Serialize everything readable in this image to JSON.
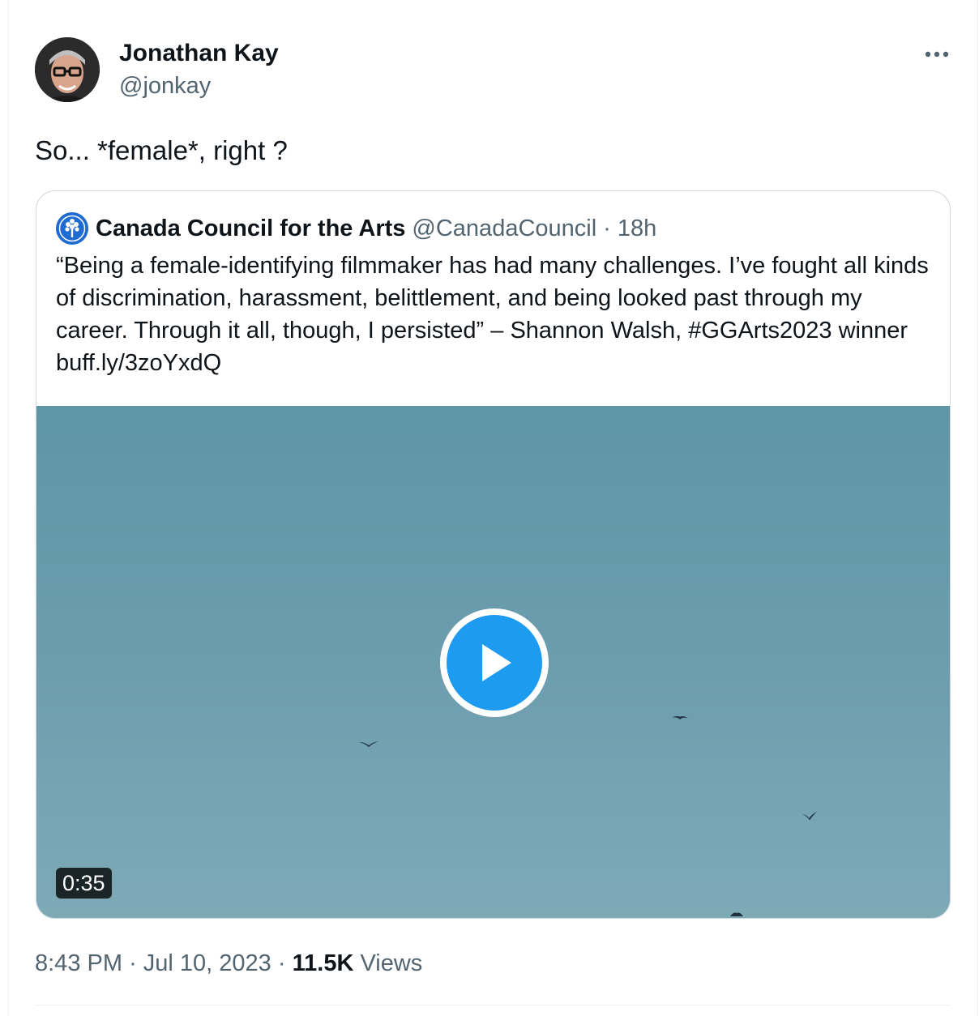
{
  "tweet": {
    "author": {
      "name": "Jonathan Kay",
      "handle": "@jonkay"
    },
    "text": "So... *female*, right ?",
    "timestamp_time": "8:43 PM",
    "separator": "·",
    "timestamp_date": "Jul 10, 2023",
    "views_count": "11.5K",
    "views_label": "Views"
  },
  "quote": {
    "author": {
      "name": "Canada Council for the Arts",
      "handle": "@CanadaCouncil"
    },
    "separator": "·",
    "time": "18h",
    "text": "“Being a female-identifying filmmaker has had many challenges. I’ve fought all kinds of discrimination, harassment, belittlement, and being looked past through my career. Through it all, though, I persisted” – Shannon Walsh, #GGArts2023 winner buff.ly/3zoYxdQ",
    "video": {
      "duration": "0:35",
      "play_icon": "play-icon"
    }
  },
  "icons": {
    "more": "more-horizontal-icon",
    "avatar": "avatar-photo",
    "quote_avatar": "canada-council-logo"
  },
  "colors": {
    "accent": "#1d9bf0",
    "secondary_text": "#536471",
    "border": "#cfd9de",
    "video_sky": "#6c9dae"
  }
}
